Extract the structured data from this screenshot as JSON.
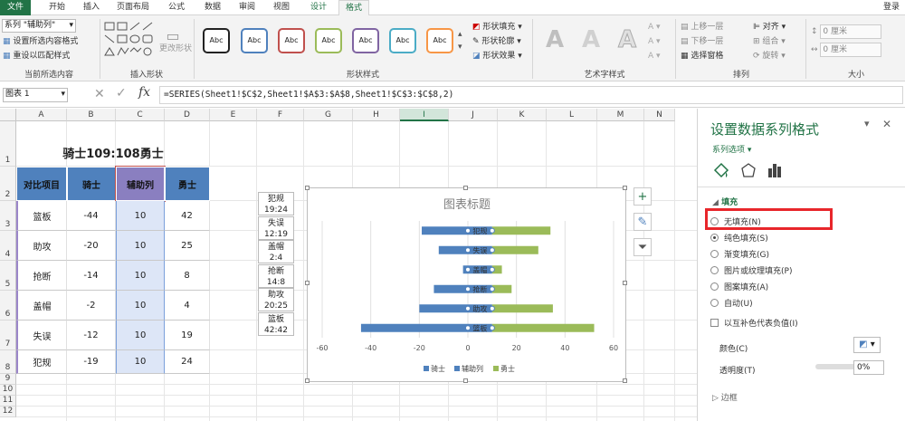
{
  "tabs": [
    "文件",
    "开始",
    "插入",
    "页面布局",
    "公式",
    "数据",
    "审阅",
    "视图",
    "设计",
    "格式"
  ],
  "login": "登录",
  "ribbon": {
    "series_select": "系列 \"辅助列\"",
    "format_selection": "设置所选内容格式",
    "reset_style": "重设以匹配样式",
    "group_current": "当前所选内容",
    "change_shape": "更改形状",
    "group_insert_shapes": "插入形状",
    "shape_style_text": "Abc",
    "shape_fill": "形状填充",
    "shape_outline": "形状轮廓",
    "shape_effects": "形状效果",
    "group_shape_styles": "形状样式",
    "wordart_letter": "A",
    "group_wordart": "艺术字样式",
    "bring_forward": "上移一层",
    "send_backward": "下移一层",
    "selection_pane": "选择窗格",
    "align": "对齐",
    "group": "组合",
    "rotate": "旋转",
    "group_arrange": "排列",
    "height": "0 厘米",
    "width": "0 厘米",
    "group_size": "大小"
  },
  "formula_bar": {
    "name_box": "图表 1",
    "fx": "fx",
    "formula": "=SERIES(Sheet1!$C$2,Sheet1!$A$3:$A$8,Sheet1!$C$3:$C$8,2)"
  },
  "sheet": {
    "columns": [
      "A",
      "B",
      "C",
      "D",
      "E",
      "F",
      "G",
      "H",
      "I",
      "J",
      "K",
      "L",
      "M",
      "N"
    ],
    "rows": [
      "1",
      "2",
      "3",
      "4",
      "5",
      "6",
      "7",
      "8",
      "9",
      "10",
      "11",
      "12"
    ],
    "title": "骑士109:108勇士",
    "headers": [
      "对比项目",
      "骑士",
      "辅助列",
      "勇士"
    ],
    "data": [
      [
        "篮板",
        "-44",
        "10",
        "42"
      ],
      [
        "助攻",
        "-20",
        "10",
        "25"
      ],
      [
        "抢断",
        "-14",
        "10",
        "8"
      ],
      [
        "盖帽",
        "-2",
        "10",
        "4"
      ],
      [
        "失误",
        "-12",
        "10",
        "19"
      ],
      [
        "犯规",
        "-19",
        "10",
        "24"
      ]
    ],
    "side_labels": [
      [
        "犯规",
        "19:24"
      ],
      [
        "失误",
        "12:19"
      ],
      [
        "盖帽",
        "2:4"
      ],
      [
        "抢断",
        "14:8"
      ],
      [
        "助攻",
        "20:25"
      ],
      [
        "篮板",
        "42:42"
      ]
    ]
  },
  "chart_data": {
    "type": "bar",
    "title": "图表标题",
    "categories": [
      "篮板",
      "助攻",
      "抢断",
      "盖帽",
      "失误",
      "犯规"
    ],
    "series": [
      {
        "name": "骑士",
        "values": [
          -44,
          -20,
          -14,
          -2,
          -12,
          -19
        ],
        "color": "#4f81bd"
      },
      {
        "name": "辅助列",
        "values": [
          10,
          10,
          10,
          10,
          10,
          10
        ],
        "color": "#4f81bd"
      },
      {
        "name": "勇士",
        "values": [
          42,
          25,
          8,
          4,
          19,
          24
        ],
        "color": "#9bbb59"
      }
    ],
    "xlim": [
      -60,
      60
    ],
    "xticks": [
      "-60",
      "-40",
      "-20",
      "0",
      "20",
      "40",
      "60"
    ],
    "legend": "bottom"
  },
  "pane": {
    "title": "设置数据系列格式",
    "series_options": "系列选项",
    "section_fill": "填充",
    "options": [
      "无填充(N)",
      "纯色填充(S)",
      "渐变填充(G)",
      "图片或纹理填充(P)",
      "图案填充(A)",
      "自动(U)"
    ],
    "selected_option": 1,
    "invert_if_negative": "以互补色代表负值(I)",
    "color_label": "颜色(C)",
    "transparency_label": "透明度(T)",
    "transparency_value": "0%",
    "border_section": "边框",
    "highlight_color": "#e8262b"
  },
  "colors": {
    "accent": "#217346",
    "header_fill": "#4f81bd",
    "knight_bar": "#4f81bd",
    "warriors_bar": "#9bbb59"
  }
}
